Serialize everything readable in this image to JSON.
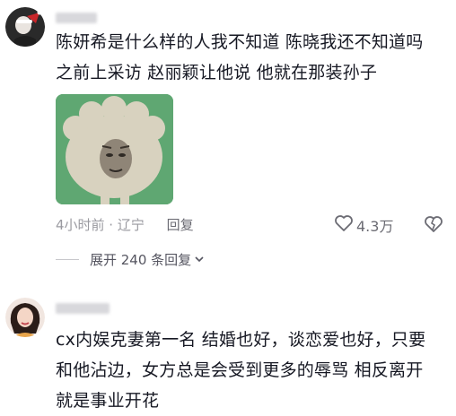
{
  "comment1": {
    "text": "陈妍希是什么样的人我不知道 陈晓我还不知道吗\n之前上采访 赵丽颖让他说 他就在那装孙子",
    "time_location": "4小时前 · 辽宁",
    "reply_label": "回复",
    "like_count": "4.3万",
    "expand_label": "展开 240 条回复",
    "icons": [
      "heart-outline-icon",
      "broken-heart-icon",
      "chevron-down-icon"
    ]
  },
  "comment2": {
    "text": "cx内娱克妻第一名 结婚也好，谈恋爱也好，只要\n和他沾边，女方总是会受到更多的辱骂 相反离开\n就是事业开花"
  }
}
